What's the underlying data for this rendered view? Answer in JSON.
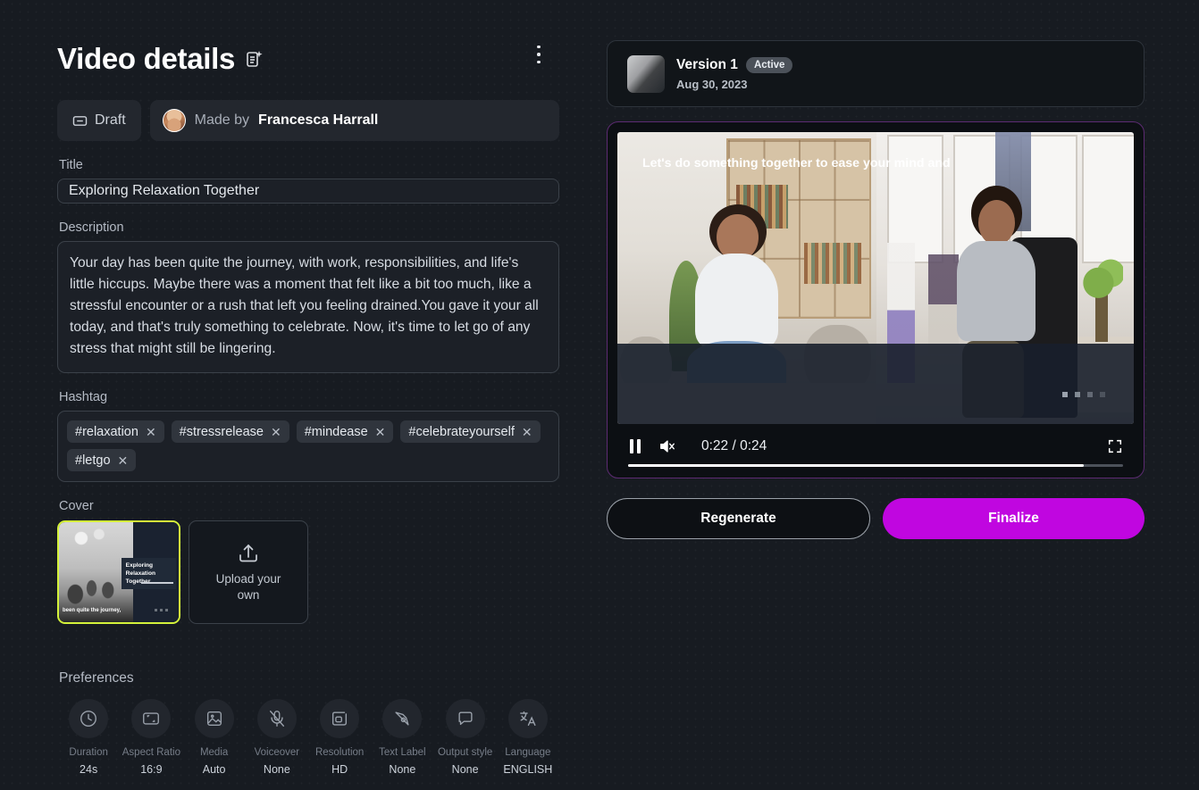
{
  "header": {
    "title": "Video details",
    "title_icon": "document-sparkle-icon",
    "menu_icon": "kebab-menu-icon"
  },
  "meta": {
    "status_label": "Draft",
    "status_icon": "archive-icon",
    "made_by_label": "Made by",
    "author": "Francesca Harrall"
  },
  "form": {
    "title_label": "Title",
    "title_value": "Exploring Relaxation Together",
    "description_label": "Description",
    "description_value": "Your day has been quite the journey, with work, responsibilities, and life's little hiccups. Maybe there was a moment that felt like a bit too much, like a stressful encounter or a rush that left you feeling drained.You gave it your all today, and that's truly something to celebrate. Now, it's time to let go of any stress that might still be lingering.",
    "hashtag_label": "Hashtag",
    "hashtags": [
      "#relaxation",
      "#stressrelease",
      "#mindease",
      "#celebrateyourself",
      "#letgo"
    ],
    "remove_glyph": "✕"
  },
  "cover": {
    "label": "Cover",
    "selected_border_color": "#d4f23a",
    "thumb_caption": "Exploring Relaxation Together",
    "thumb_subtitle": "been quite the journey,",
    "upload_label": "Upload your own",
    "upload_icon": "upload-icon"
  },
  "preferences": {
    "label": "Preferences",
    "items": [
      {
        "icon": "clock-icon",
        "name": "Duration",
        "value": "24s"
      },
      {
        "icon": "aspect-ratio-icon",
        "name": "Aspect Ratio",
        "value": "16:9"
      },
      {
        "icon": "image-icon",
        "name": "Media",
        "value": "Auto"
      },
      {
        "icon": "mic-off-icon",
        "name": "Voiceover",
        "value": "None"
      },
      {
        "icon": "resolution-icon",
        "name": "Resolution",
        "value": "HD"
      },
      {
        "icon": "pen-tool-icon",
        "name": "Text Label",
        "value": "None"
      },
      {
        "icon": "speech-bubble-icon",
        "name": "Output style",
        "value": "None"
      },
      {
        "icon": "translate-icon",
        "name": "Language",
        "value": "ENGLISH"
      }
    ]
  },
  "version": {
    "title": "Version 1",
    "badge": "Active",
    "date": "Aug 30, 2023",
    "thumbnail_icon": "video-thumbnail"
  },
  "player": {
    "border_color": "#5c2b72",
    "caption": "Let's do something together to ease your mind and",
    "play_state_icon": "pause-icon",
    "volume_icon": "volume-muted-icon",
    "fullscreen_icon": "fullscreen-icon",
    "current_time": "0:22",
    "separator": "/",
    "total_time": "0:24",
    "time_display": "0:22 / 0:24",
    "progress_percent": 92
  },
  "actions": {
    "regenerate_label": "Regenerate",
    "finalize_label": "Finalize",
    "finalize_color": "#c006e0"
  }
}
